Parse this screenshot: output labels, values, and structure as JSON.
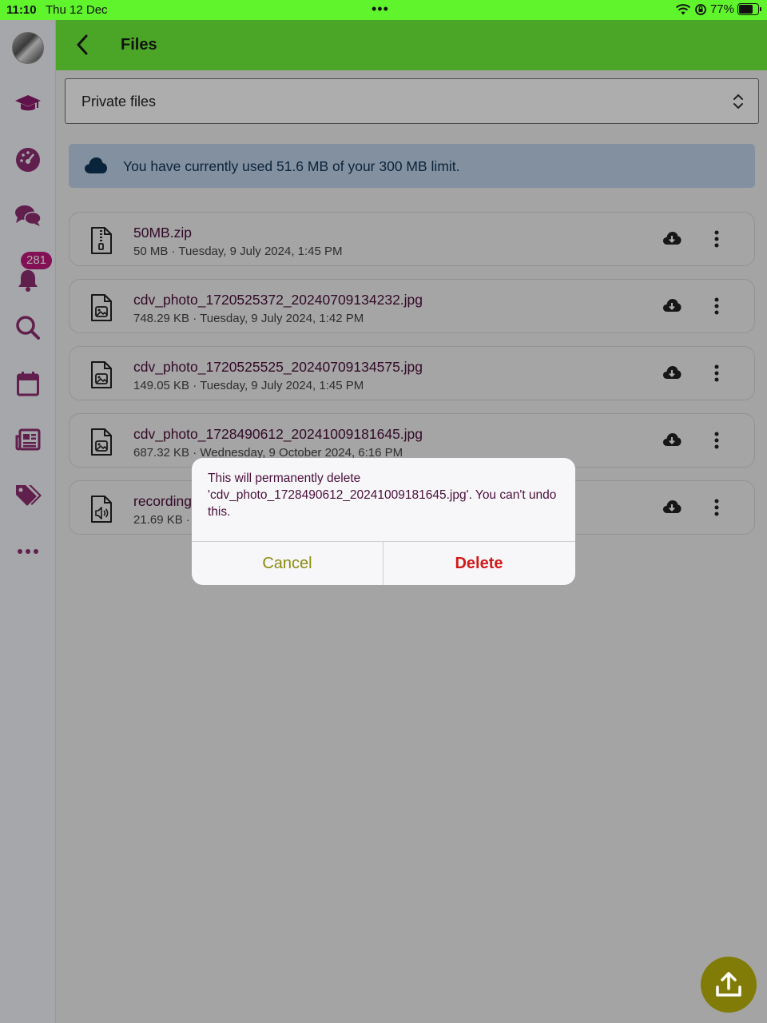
{
  "status_bar": {
    "time": "11:10",
    "date": "Thu 12 Dec",
    "dots": "•••",
    "battery_pct": "77%",
    "battery_level": 0.77
  },
  "rail": {
    "items": [
      {
        "icon": "graduation-cap-icon"
      },
      {
        "icon": "dashboard-gauge-icon"
      },
      {
        "icon": "chat-bubbles-icon"
      },
      {
        "icon": "bell-icon"
      },
      {
        "icon": "search-icon"
      },
      {
        "icon": "calendar-icon"
      },
      {
        "icon": "newspaper-icon"
      },
      {
        "icon": "tags-icon"
      },
      {
        "icon": "more-dots-icon"
      }
    ],
    "notification_count": "281"
  },
  "header": {
    "title": "Files"
  },
  "selector": {
    "value": "Private files"
  },
  "quota": {
    "text": "You have currently used 51.6 MB of your 300 MB limit."
  },
  "files": [
    {
      "name": "50MB.zip",
      "meta": "50 MB · Tuesday, 9 July 2024, 1:45 PM",
      "icon": "zip-file-icon"
    },
    {
      "name": "cdv_photo_1720525372_20240709134232.jpg",
      "meta": "748.29 KB · Tuesday, 9 July 2024, 1:42 PM",
      "icon": "image-file-icon"
    },
    {
      "name": "cdv_photo_1720525525_20240709134575.jpg",
      "meta": "149.05 KB · Tuesday, 9 July 2024, 1:45 PM",
      "icon": "image-file-icon"
    },
    {
      "name": "cdv_photo_1728490612_20241009181645.jpg",
      "meta": "687.32 KB · Wednesday, 9 October 2024, 6:16 PM",
      "icon": "image-file-icon"
    },
    {
      "name": "recording",
      "meta": "21.69 KB ·",
      "icon": "audio-file-icon"
    }
  ],
  "dialog": {
    "message": "This will permanently delete 'cdv_photo_1728490612_20241009181645.jpg'. You can't undo this.",
    "cancel_label": "Cancel",
    "delete_label": "Delete"
  },
  "colors": {
    "header_green": "#6ff53a",
    "brand_purple": "#7b1f62",
    "delete_red": "#d11a1a",
    "fab_olive": "#817c08"
  }
}
